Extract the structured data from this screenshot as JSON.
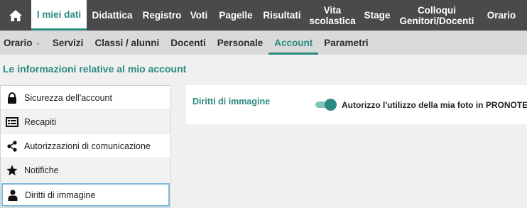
{
  "topnav": {
    "items": [
      {
        "label": "I miei dati"
      },
      {
        "label": "Didattica"
      },
      {
        "label": "Registro"
      },
      {
        "label": "Voti"
      },
      {
        "label": "Pagelle"
      },
      {
        "label": "Risultati"
      },
      {
        "label": "Vita scolastica"
      },
      {
        "label": "Stage"
      },
      {
        "label": "Colloqui Genitori/Docenti"
      },
      {
        "label": "Orario"
      }
    ]
  },
  "subnav": {
    "items": [
      {
        "label": "Orario"
      },
      {
        "label": "Servizi"
      },
      {
        "label": "Classi / alunni"
      },
      {
        "label": "Docenti"
      },
      {
        "label": "Personale"
      },
      {
        "label": "Account"
      },
      {
        "label": "Parametri"
      }
    ]
  },
  "page_title": "Le informazioni relative al mio account",
  "leftmenu": {
    "items": [
      {
        "label": "Sicurezza dell'account",
        "icon": "lock-icon"
      },
      {
        "label": "Recapiti",
        "icon": "contact-card-icon"
      },
      {
        "label": "Autorizzazioni di comunicazione",
        "icon": "share-icon"
      },
      {
        "label": "Notifiche",
        "icon": "star-icon"
      },
      {
        "label": "Diritti di immagine",
        "icon": "user-icon"
      }
    ]
  },
  "panel": {
    "label": "Diritti di immagine",
    "toggle_label": "Autorizzo l'utilizzo della mia foto in PRONOTE",
    "toggle_on": true
  },
  "colors": {
    "accent": "#2b8a80",
    "topnav_bg": "#4a4a4a",
    "subnav_bg": "#dadada",
    "selected_border": "#7ab8d6"
  }
}
